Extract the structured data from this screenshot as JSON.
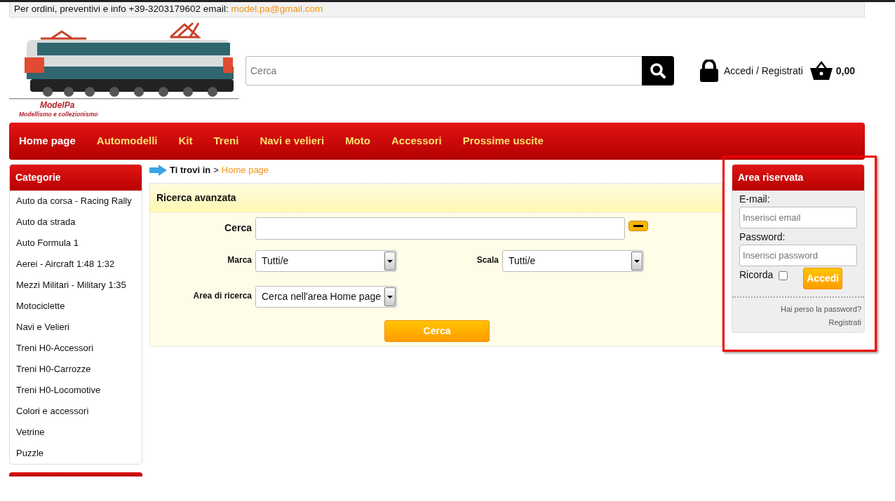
{
  "top_bar": {
    "contact_text": "Per ordini, preventivi e info  +39-3203179602   email:",
    "email": "model.pa@gmail.com"
  },
  "logo": {
    "name": "ModelPa",
    "tagline": "Modellismo e collezionismo"
  },
  "search": {
    "placeholder": "Cerca"
  },
  "account_link": "Accedi / Registrati",
  "cart_total": "0,00",
  "nav": [
    {
      "label": "Home page",
      "selected": true
    },
    {
      "label": "Automodelli",
      "selected": false
    },
    {
      "label": "Kit",
      "selected": false
    },
    {
      "label": "Treni",
      "selected": false
    },
    {
      "label": "Navi e velieri",
      "selected": false
    },
    {
      "label": "Moto",
      "selected": false
    },
    {
      "label": "Accessori",
      "selected": false
    },
    {
      "label": "Prossime uscite",
      "selected": false
    }
  ],
  "sidebar": {
    "title": "Categorie",
    "items": [
      "Auto da corsa - Racing Rally",
      "Auto da strada",
      "Auto Formula 1",
      "Aerei - Aircraft 1:48 1:32",
      "Mezzi Militari - Military 1:35",
      "Motociclette",
      "Navi e Velieri",
      "Treni H0-Accessori",
      "Treni H0-Carrozze",
      "Treni H0-Locomotive",
      "Colori e accessori",
      "Vetrine",
      "Puzzle"
    ]
  },
  "breadcrumb": {
    "label": "Ti trovi in",
    "separator": ">",
    "current": "Home page"
  },
  "advanced_search": {
    "title": "Ricerca avanzata",
    "fields": [
      {
        "kind": "text",
        "label": "Cerca"
      },
      {
        "kind": "select",
        "label": "Marca",
        "value": "Tutti/e"
      },
      {
        "kind": "select",
        "label": "Scala",
        "value": "Tutti/e"
      },
      {
        "kind": "select",
        "label": "Area di ricerca",
        "value": "Cerca nell'area Home page"
      }
    ],
    "submit": "Cerca"
  },
  "login": {
    "title": "Area riservata",
    "email_label": "E-mail:",
    "email_placeholder": "Inserisci email",
    "password_label": "Password:",
    "password_placeholder": "Inserisci password",
    "remember_label": "Ricorda",
    "remember_checked": false,
    "submit": "Accedi",
    "links": [
      "Hai perso la password?",
      "Registrati"
    ]
  }
}
